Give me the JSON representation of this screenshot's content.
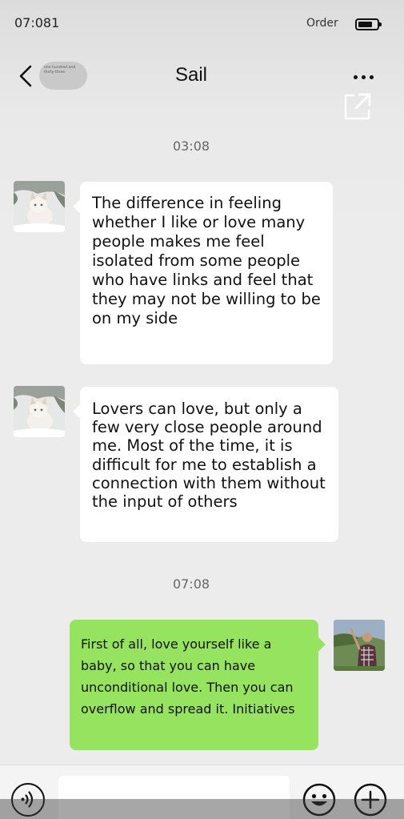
{
  "status_bar": {
    "time": "07:081",
    "carrier": "Order",
    "battery_icon": "battery-icon"
  },
  "header": {
    "back_icon": "chevron-left-icon",
    "unread_badge": "one hundred and thirty-three",
    "title": "Sail",
    "more_icon": "more-dots-icon",
    "share_icon": "share-out-icon"
  },
  "messages": [
    {
      "type": "timestamp",
      "text": "03:08"
    },
    {
      "type": "incoming",
      "avatar": "cat-avatar",
      "text": "The difference in feeling whether I like or love many people makes me feel isolated from some people who have links and feel that they may not be willing to be on my side"
    },
    {
      "type": "incoming",
      "avatar": "cat-avatar",
      "text": "Lovers can love, but only a few very close people around me. Most of the time, it is difficult for me to establish a connection with them without the input of others"
    },
    {
      "type": "timestamp",
      "text": "07:08"
    },
    {
      "type": "outgoing",
      "avatar": "user-avatar",
      "text": "First of all, love yourself like a baby, so that you can have unconditional love. Then you can overflow and spread it. Initiatives"
    }
  ],
  "input_bar": {
    "voice_icon": "voice-icon",
    "input_value": "",
    "emoji_icon": "emoji-icon",
    "plus_icon": "plus-icon"
  },
  "colors": {
    "outgoing_bubble": "#95e35f",
    "incoming_bubble": "#ffffff",
    "background": "#ececec"
  }
}
